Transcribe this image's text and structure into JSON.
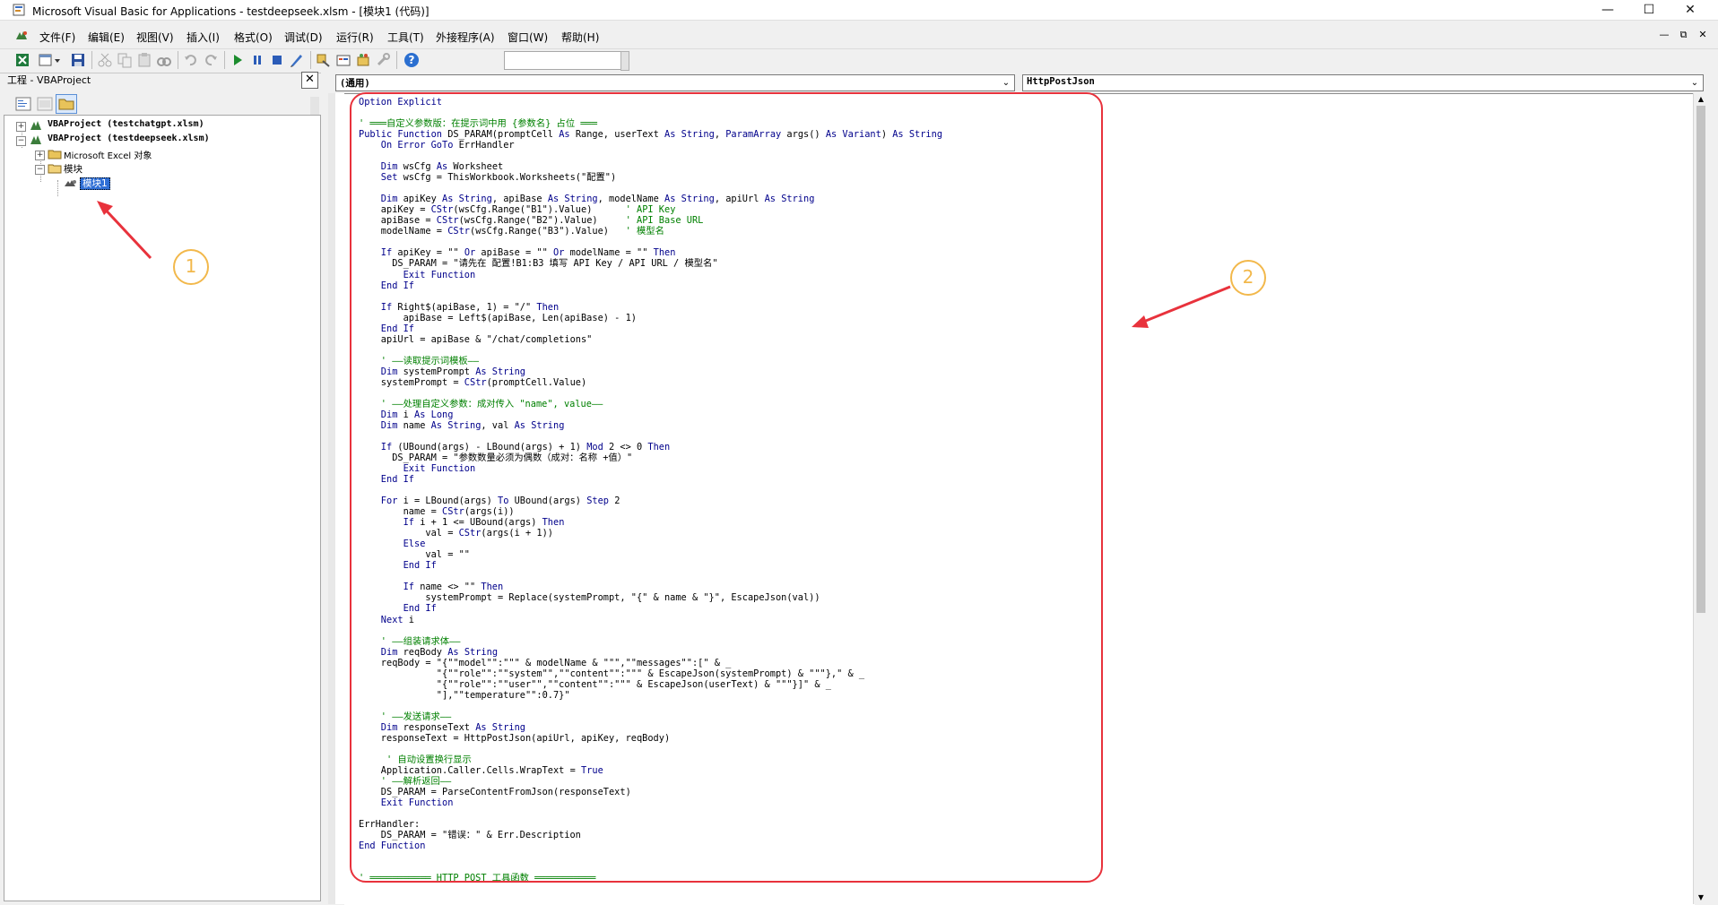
{
  "window": {
    "title": "Microsoft Visual Basic for Applications - testdeepseek.xlsm - [模块1 (代码)]",
    "minimize": "—",
    "maximize": "☐",
    "close": "✕"
  },
  "menu": {
    "items": [
      "文件(F)",
      "编辑(E)",
      "视图(V)",
      "插入(I)",
      "格式(O)",
      "调试(D)",
      "运行(R)",
      "工具(T)",
      "外接程序(A)",
      "窗口(W)",
      "帮助(H)"
    ],
    "mdi": [
      "—",
      "⧉",
      "✕"
    ]
  },
  "project": {
    "title": "工程 - VBAProject",
    "close": "✕",
    "tree": [
      {
        "label": "VBAProject (testchatgpt.xlsm)",
        "expander": "+"
      },
      {
        "label": "VBAProject (testdeepseek.xlsm)",
        "expander": "−"
      },
      {
        "label": "Microsoft Excel 对象",
        "expander": "+"
      },
      {
        "label": "模块",
        "expander": "−"
      },
      {
        "label": "模块1"
      }
    ]
  },
  "code": {
    "object_dropdown": "(通用)",
    "procedure_dropdown": "HttpPostJson",
    "lines": [
      [
        [
          "kw",
          "Option Explicit"
        ]
      ],
      [
        [
          "tx",
          ""
        ]
      ],
      [
        [
          "cm",
          "' ═══自定义参数版：在提示词中用 {参数名} 占位 ═══"
        ]
      ],
      [
        [
          "kw",
          "Public Function "
        ],
        [
          "tx",
          "DS_PARAM(promptCell "
        ],
        [
          "kw",
          "As "
        ],
        [
          "tx",
          "Range, userText "
        ],
        [
          "kw",
          "As String"
        ],
        [
          "tx",
          ", "
        ],
        [
          "kw",
          "ParamArray "
        ],
        [
          "tx",
          "args() "
        ],
        [
          "kw",
          "As Variant"
        ],
        [
          "tx",
          ") "
        ],
        [
          "kw",
          "As String"
        ]
      ],
      [
        [
          "kw",
          "    On Error GoTo "
        ],
        [
          "tx",
          "ErrHandler"
        ]
      ],
      [
        [
          "tx",
          ""
        ]
      ],
      [
        [
          "kw",
          "    Dim "
        ],
        [
          "tx",
          "wsCfg "
        ],
        [
          "kw",
          "As "
        ],
        [
          "tx",
          "Worksheet"
        ]
      ],
      [
        [
          "kw",
          "    Set "
        ],
        [
          "tx",
          "wsCfg = ThisWorkbook.Worksheets(\"配置\")"
        ]
      ],
      [
        [
          "tx",
          ""
        ]
      ],
      [
        [
          "kw",
          "    Dim "
        ],
        [
          "tx",
          "apiKey "
        ],
        [
          "kw",
          "As String"
        ],
        [
          "tx",
          ", apiBase "
        ],
        [
          "kw",
          "As String"
        ],
        [
          "tx",
          ", modelName "
        ],
        [
          "kw",
          "As String"
        ],
        [
          "tx",
          ", apiUrl "
        ],
        [
          "kw",
          "As String"
        ]
      ],
      [
        [
          "tx",
          "    apiKey = "
        ],
        [
          "kw",
          "CStr"
        ],
        [
          "tx",
          "(wsCfg.Range(\"B1\").Value)      "
        ],
        [
          "cm",
          "' API Key"
        ]
      ],
      [
        [
          "tx",
          "    apiBase = "
        ],
        [
          "kw",
          "CStr"
        ],
        [
          "tx",
          "(wsCfg.Range(\"B2\").Value)     "
        ],
        [
          "cm",
          "' API Base URL"
        ]
      ],
      [
        [
          "tx",
          "    modelName = "
        ],
        [
          "kw",
          "CStr"
        ],
        [
          "tx",
          "(wsCfg.Range(\"B3\").Value)   "
        ],
        [
          "cm",
          "' 模型名"
        ]
      ],
      [
        [
          "tx",
          ""
        ]
      ],
      [
        [
          "kw",
          "    If "
        ],
        [
          "tx",
          "apiKey = \"\" "
        ],
        [
          "kw",
          "Or "
        ],
        [
          "tx",
          "apiBase = \"\" "
        ],
        [
          "kw",
          "Or "
        ],
        [
          "tx",
          "modelName = \"\" "
        ],
        [
          "kw",
          "Then"
        ]
      ],
      [
        [
          "tx",
          "      DS_PARAM = \"请先在 配置!B1:B3 填写 API Key / API URL / 模型名\""
        ]
      ],
      [
        [
          "kw",
          "        Exit Function"
        ]
      ],
      [
        [
          "kw",
          "    End If"
        ]
      ],
      [
        [
          "tx",
          ""
        ]
      ],
      [
        [
          "kw",
          "    If "
        ],
        [
          "tx",
          "Right$(apiBase, 1) = \"/\" "
        ],
        [
          "kw",
          "Then"
        ]
      ],
      [
        [
          "tx",
          "        apiBase = Left$(apiBase, Len(apiBase) - 1)"
        ]
      ],
      [
        [
          "kw",
          "    End If"
        ]
      ],
      [
        [
          "tx",
          "    apiUrl = apiBase & \"/chat/completions\""
        ]
      ],
      [
        [
          "tx",
          ""
        ]
      ],
      [
        [
          "cm",
          "    ' ——读取提示词模板——"
        ]
      ],
      [
        [
          "kw",
          "    Dim "
        ],
        [
          "tx",
          "systemPrompt "
        ],
        [
          "kw",
          "As String"
        ]
      ],
      [
        [
          "tx",
          "    systemPrompt = "
        ],
        [
          "kw",
          "CStr"
        ],
        [
          "tx",
          "(promptCell.Value)"
        ]
      ],
      [
        [
          "tx",
          ""
        ]
      ],
      [
        [
          "cm",
          "    ' ——处理自定义参数：成对传入 \"name\", value——"
        ]
      ],
      [
        [
          "kw",
          "    Dim "
        ],
        [
          "tx",
          "i "
        ],
        [
          "kw",
          "As Long"
        ]
      ],
      [
        [
          "kw",
          "    Dim "
        ],
        [
          "tx",
          "name "
        ],
        [
          "kw",
          "As String"
        ],
        [
          "tx",
          ", val "
        ],
        [
          "kw",
          "As String"
        ]
      ],
      [
        [
          "tx",
          ""
        ]
      ],
      [
        [
          "kw",
          "    If "
        ],
        [
          "tx",
          "(UBound(args) - LBound(args) + 1) "
        ],
        [
          "kw",
          "Mod "
        ],
        [
          "tx",
          "2 <> 0 "
        ],
        [
          "kw",
          "Then"
        ]
      ],
      [
        [
          "tx",
          "      DS_PARAM = \"参数数量必须为偶数（成对：名称 +值）\""
        ]
      ],
      [
        [
          "kw",
          "        Exit Function"
        ]
      ],
      [
        [
          "kw",
          "    End If"
        ]
      ],
      [
        [
          "tx",
          ""
        ]
      ],
      [
        [
          "kw",
          "    For "
        ],
        [
          "tx",
          "i = LBound(args) "
        ],
        [
          "kw",
          "To "
        ],
        [
          "tx",
          "UBound(args) "
        ],
        [
          "kw",
          "Step "
        ],
        [
          "tx",
          "2"
        ]
      ],
      [
        [
          "tx",
          "        name = "
        ],
        [
          "kw",
          "CStr"
        ],
        [
          "tx",
          "(args(i))"
        ]
      ],
      [
        [
          "kw",
          "        If "
        ],
        [
          "tx",
          "i + 1 <= UBound(args) "
        ],
        [
          "kw",
          "Then"
        ]
      ],
      [
        [
          "tx",
          "            val = "
        ],
        [
          "kw",
          "CStr"
        ],
        [
          "tx",
          "(args(i + 1))"
        ]
      ],
      [
        [
          "kw",
          "        Else"
        ]
      ],
      [
        [
          "tx",
          "            val = \"\""
        ]
      ],
      [
        [
          "kw",
          "        End If"
        ]
      ],
      [
        [
          "tx",
          ""
        ]
      ],
      [
        [
          "kw",
          "        If "
        ],
        [
          "tx",
          "name <> \"\" "
        ],
        [
          "kw",
          "Then"
        ]
      ],
      [
        [
          "tx",
          "            systemPrompt = Replace(systemPrompt, \"{\" & name & \"}\", EscapeJson(val))"
        ]
      ],
      [
        [
          "kw",
          "        End If"
        ]
      ],
      [
        [
          "kw",
          "    Next "
        ],
        [
          "tx",
          "i"
        ]
      ],
      [
        [
          "tx",
          ""
        ]
      ],
      [
        [
          "cm",
          "    ' ——组装请求体——"
        ]
      ],
      [
        [
          "kw",
          "    Dim "
        ],
        [
          "tx",
          "reqBody "
        ],
        [
          "kw",
          "As String"
        ]
      ],
      [
        [
          "tx",
          "    reqBody = \"{\"\"model\"\":\"\"\" & modelName & \"\"\",\"\"messages\"\":[\" & _"
        ]
      ],
      [
        [
          "tx",
          "              \"{\"\"role\"\":\"\"system\"\",\"\"content\"\":\"\"\" & EscapeJson(systemPrompt) & \"\"\"},\" & _"
        ]
      ],
      [
        [
          "tx",
          "              \"{\"\"role\"\":\"\"user\"\",\"\"content\"\":\"\"\" & EscapeJson(userText) & \"\"\"}]\" & _"
        ]
      ],
      [
        [
          "tx",
          "              \"],\"\"temperature\"\":0.7}\""
        ]
      ],
      [
        [
          "tx",
          ""
        ]
      ],
      [
        [
          "cm",
          "    ' ——发送请求——"
        ]
      ],
      [
        [
          "kw",
          "    Dim "
        ],
        [
          "tx",
          "responseText "
        ],
        [
          "kw",
          "As String"
        ]
      ],
      [
        [
          "tx",
          "    responseText = HttpPostJson(apiUrl, apiKey, reqBody)"
        ]
      ],
      [
        [
          "tx",
          ""
        ]
      ],
      [
        [
          "cm",
          "     ' 自动设置换行显示"
        ]
      ],
      [
        [
          "tx",
          "    Application.Caller.Cells.WrapText = "
        ],
        [
          "kw",
          "True"
        ]
      ],
      [
        [
          "cm",
          "    ' ——解析返回——"
        ]
      ],
      [
        [
          "tx",
          "    DS_PARAM = ParseContentFromJson(responseText)"
        ]
      ],
      [
        [
          "kw",
          "    Exit Function"
        ]
      ],
      [
        [
          "tx",
          ""
        ]
      ],
      [
        [
          "tx",
          "ErrHandler:"
        ]
      ],
      [
        [
          "tx",
          "    DS_PARAM = \"错误：\" & Err.Description"
        ]
      ],
      [
        [
          "kw",
          "End Function"
        ]
      ],
      [
        [
          "tx",
          ""
        ]
      ],
      [
        [
          "tx",
          ""
        ]
      ],
      [
        [
          "cm",
          "' ═══════════ HTTP POST 工具函数 ═══════════"
        ]
      ]
    ]
  },
  "annotations": {
    "marker_1": "1",
    "marker_2": "2",
    "color_box": "#e8323c",
    "color_marker": "#f2b84b"
  }
}
